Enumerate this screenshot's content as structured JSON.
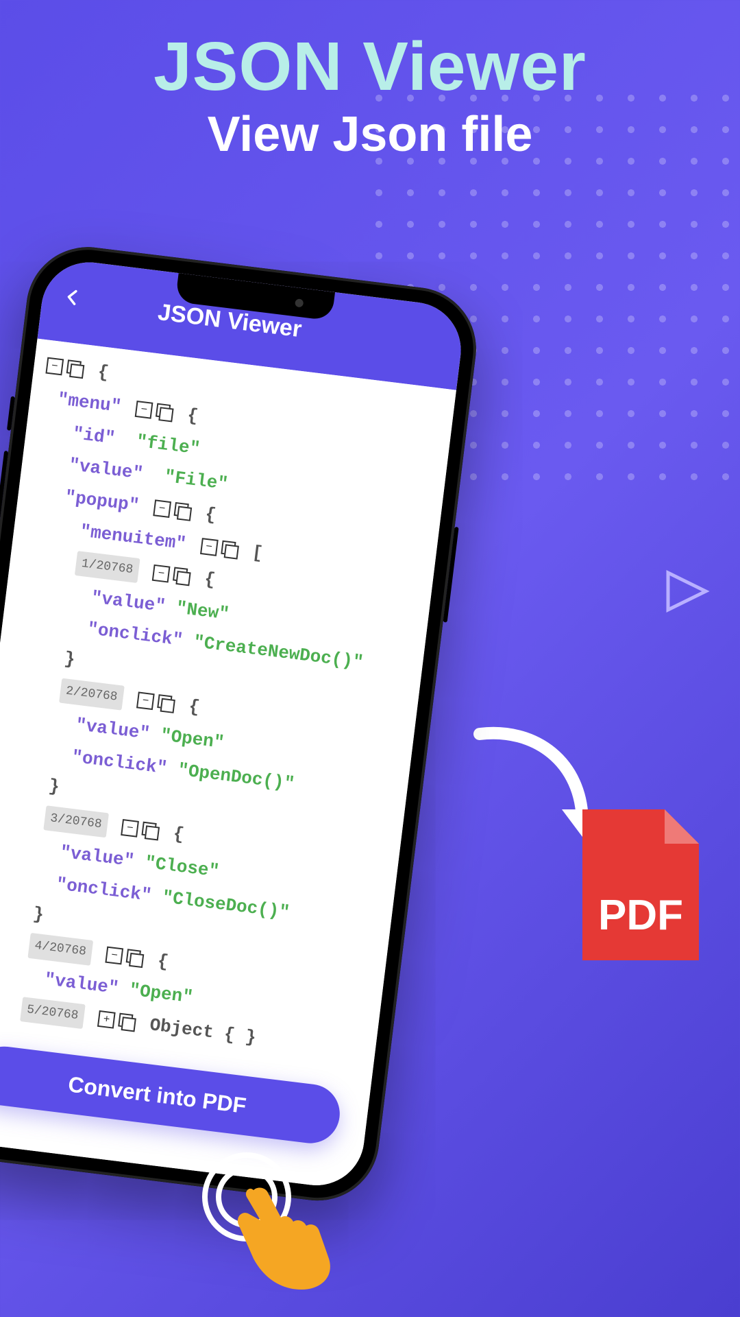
{
  "heading": {
    "title": "JSON Viewer",
    "subtitle": "View Json file"
  },
  "app": {
    "header_title": "JSON Viewer",
    "convert_button": "Convert into PDF"
  },
  "tree": {
    "root_open": "{",
    "menu_key": "\"menu\"",
    "menu_open": "{",
    "id_key": "\"id\"",
    "id_val": "\"file\"",
    "value_key": "\"value\"",
    "value_val": "\"File\"",
    "popup_key": "\"popup\"",
    "popup_open": "{",
    "menuitem_key": "\"menuitem\"",
    "menuitem_open": "[",
    "items": [
      {
        "index": "1/20768",
        "open": "{",
        "value_key": "\"value\"",
        "value_val": "\"New\"",
        "onclick_key": "\"onclick\"",
        "onclick_val": "\"CreateNewDoc()\"",
        "close": "}"
      },
      {
        "index": "2/20768",
        "open": "{",
        "value_key": "\"value\"",
        "value_val": "\"Open\"",
        "onclick_key": "\"onclick\"",
        "onclick_val": "\"OpenDoc()\"",
        "close": "}"
      },
      {
        "index": "3/20768",
        "open": "{",
        "value_key": "\"value\"",
        "value_val": "\"Close\"",
        "onclick_key": "\"onclick\"",
        "onclick_val": "\"CloseDoc()\"",
        "close": "}"
      },
      {
        "index": "4/20768",
        "open": "{",
        "value_key": "\"value\"",
        "value_val": "\"Open\"",
        "close": ""
      },
      {
        "index": "5/20768",
        "open": "",
        "trailing": "Object { }"
      }
    ]
  },
  "pdf_label": "PDF",
  "colors": {
    "bg1": "#5b4de8",
    "bg2": "#6a5af0",
    "accent_teal": "#b8eee8",
    "json_key": "#7b5ed4",
    "json_val": "#4caf50",
    "pdf_red": "#e53935"
  }
}
